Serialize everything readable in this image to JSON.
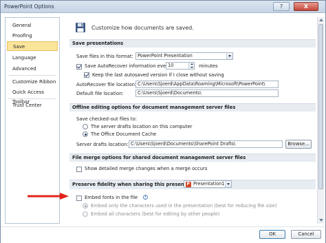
{
  "window": {
    "title": "PowerPoint Options",
    "help_label": "?",
    "close_label": "X"
  },
  "nav": {
    "items": [
      {
        "label": "General"
      },
      {
        "label": "Proofing"
      },
      {
        "label": "Save",
        "selected": true
      },
      {
        "label": "Language"
      },
      {
        "label": "Advanced"
      },
      {
        "label": "Customize Ribbon"
      },
      {
        "label": "Quick Access Toolbar"
      },
      {
        "label": "Trust Center"
      }
    ]
  },
  "header": {
    "text": "Customize how documents are saved."
  },
  "save_presentations": {
    "heading": "Save presentations",
    "format_label": "Save files in this format:",
    "format_value": "PowerPoint Presentation",
    "autorecover_label": "Save AutoRecover information every",
    "autorecover_checked": true,
    "autorecover_value": "10",
    "minutes_label": "minutes",
    "keep_last_label": "Keep the last autosaved version if I close without saving",
    "keep_last_checked": true,
    "autorecover_location_label": "AutoRecover file location:",
    "autorecover_location_value": "C:\\Users\\Sjoerd\\AppData\\Roaming\\Microsoft\\PowerPoint\\",
    "default_location_label": "Default file location:",
    "default_location_value": "C:\\Users\\Sjoerd\\Documents\\"
  },
  "offline": {
    "heading": "Offline editing options for document management server files",
    "save_to_label": "Save checked-out files to:",
    "option_server": "The server drafts location on this computer",
    "option_cache": "The Office Document Cache",
    "selected": "cache",
    "drafts_label": "Server drafts location:",
    "drafts_value": "C:\\Users\\Sjoerd\\Documents\\SharePoint Drafts\\",
    "browse_label": "Browse..."
  },
  "merge": {
    "heading": "File merge options for shared document management server files",
    "show_merge_label": "Show detailed merge changes when a merge occurs",
    "show_merge_checked": false
  },
  "fidelity": {
    "heading": "Preserve fidelity when sharing this presentation:",
    "presentation_value": "Presentation1",
    "embed_label": "Embed fonts in the file",
    "embed_checked": false,
    "embed_only_label": "Embed only the characters used in the presentation (best for reducing file size)",
    "embed_all_label": "Embed all characters (best for editing by other people)",
    "embed_option_selected": "only"
  },
  "footer": {
    "ok_label": "OK",
    "cancel_label": "Cancel"
  },
  "colors": {
    "selected_nav": "#fbe59b",
    "section_bar": "#e7ecf2",
    "arrow": "#e2231a"
  },
  "icons": {
    "save": "floppy-disk-icon",
    "info": "info-icon",
    "arrow": "red-arrow-annotation"
  }
}
